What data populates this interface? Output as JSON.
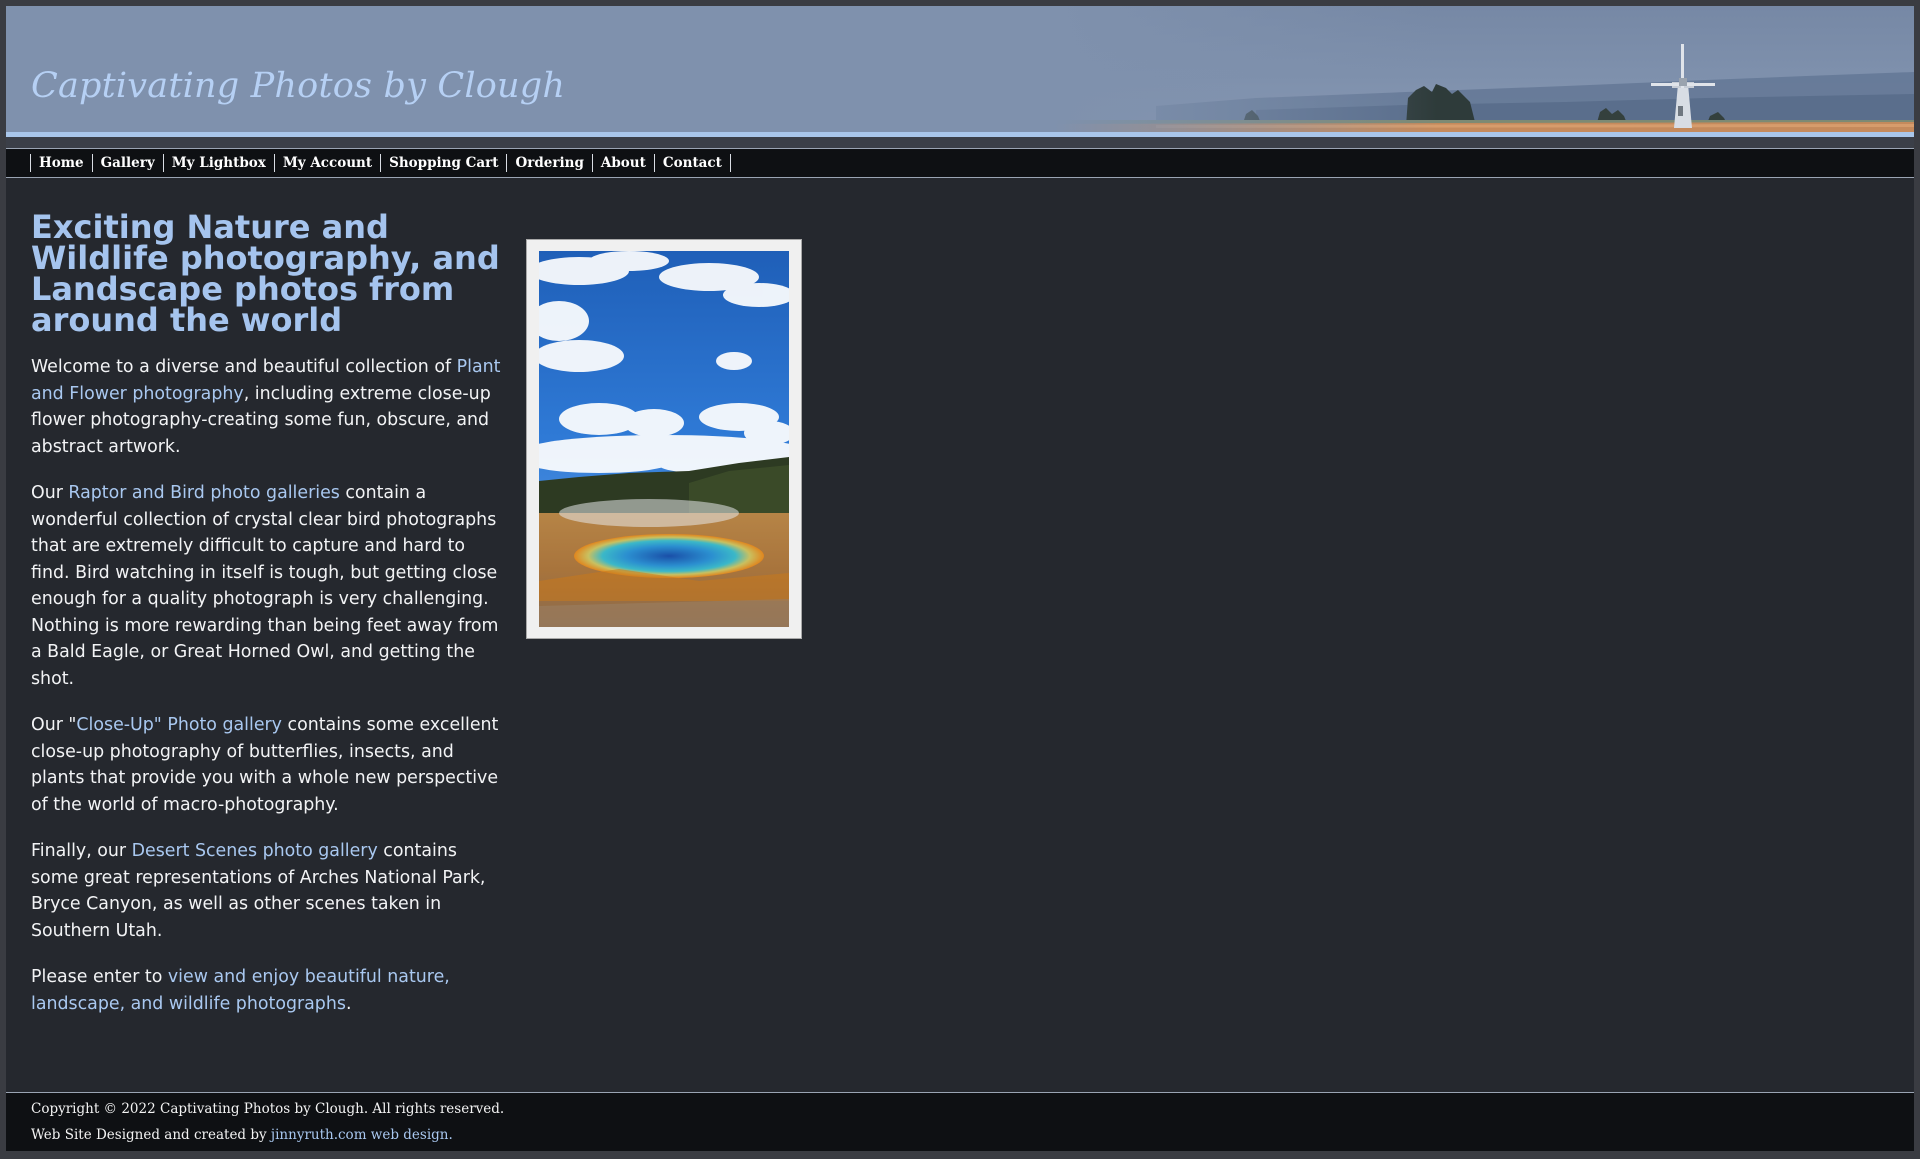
{
  "site": {
    "title": "Captivating Photos by Clough"
  },
  "nav": {
    "items": [
      {
        "label": "Home"
      },
      {
        "label": "Gallery"
      },
      {
        "label": "My Lightbox"
      },
      {
        "label": "My Account"
      },
      {
        "label": "Shopping Cart"
      },
      {
        "label": "Ordering"
      },
      {
        "label": "About"
      },
      {
        "label": "Contact"
      }
    ]
  },
  "main": {
    "heading": "Exciting Nature and Wildlife photography, and Landscape photos from around the world",
    "p1": {
      "before": "Welcome to a diverse and beautiful collection of ",
      "link": "Plant and Flower photography",
      "after": ", including extreme close-up flower photography-creating some fun, obscure, and abstract artwork."
    },
    "p2": {
      "before": "Our ",
      "link": "Raptor and Bird photo galleries",
      "after": " contain a wonderful collection of crystal clear bird photographs that are extremely difficult to capture and hard to find. Bird watching in itself is tough, but getting close enough for a quality photograph is very challenging. Nothing is more rewarding than being feet away from a Bald Eagle, or Great Horned Owl, and getting the shot."
    },
    "p3": {
      "before": "Our \"",
      "link": "Close-Up\" Photo gallery",
      "after": " contains some excellent close-up photography of butterflies, insects, and plants that provide you with a whole new perspective of the world of macro-photography."
    },
    "p4": {
      "before": "Finally, our ",
      "link": "Desert Scenes photo gallery",
      "after": " contains some great representations of Arches National Park, Bryce Canyon, as well as other scenes taken in Southern Utah."
    },
    "p5": {
      "before": "Please enter to ",
      "link": "view and enjoy beautiful nature, landscape, and wildlife photographs",
      "after": "."
    }
  },
  "footer": {
    "copyright": "Copyright © 2022 Captivating Photos by Clough. All rights reserved.",
    "designed_prefix": "Web Site Designed and created by ",
    "designed_link": "jinnyruth.com web design."
  },
  "colors": {
    "background": "#25282e",
    "heading": "#a5c4ee",
    "link": "#a9c8f0",
    "navbar": "#0e1013"
  }
}
